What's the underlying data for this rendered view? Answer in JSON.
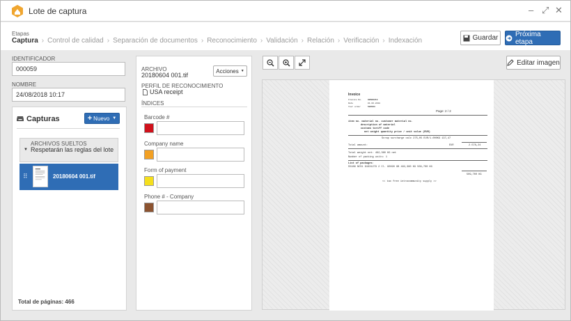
{
  "window": {
    "title": "Lote de captura",
    "minimize": "–",
    "maximize": "⤢",
    "close": "✕"
  },
  "breadcrumb": {
    "label": "Etapas",
    "steps": [
      "Captura",
      "Control de calidad",
      "Separación de documentos",
      "Reconocimiento",
      "Validación",
      "Relación",
      "Verificación",
      "Indexación"
    ],
    "separator": "›"
  },
  "toolbar": {
    "save_label": "Guardar",
    "next_label": "Próxima etapa",
    "edit_image_label": "Editar imagen"
  },
  "batch": {
    "id_label": "IDENTIFICADOR",
    "id_value": "000059",
    "name_label": "NOMBRE",
    "name_value": "24/08/2018 10:17"
  },
  "captures": {
    "title": "Capturas",
    "new_label": "Nuevo",
    "group_label": "ARCHIVOS SUELTOS",
    "group_rule": "Respetarán las reglas del lote",
    "file_name": "20180604 001.tif",
    "total_pages": "Total de páginas: 466"
  },
  "document": {
    "file_label": "ARCHIVO",
    "file_name": "20180604 001.tif",
    "actions_label": "Acciones",
    "profile_label": "PERFIL DE RECONOCIMIENTO",
    "profile_value": "USA receipt",
    "indices_label": "ÍNDICES",
    "indices": [
      {
        "label": "Barcode #",
        "color": "#d0111b",
        "value": ""
      },
      {
        "label": "Company name",
        "color": "#f2a023",
        "value": ""
      },
      {
        "label": "Form of payment",
        "color": "#f5df1d",
        "value": ""
      },
      {
        "label": "Phone # - Company",
        "color": "#8c5330",
        "value": ""
      }
    ]
  },
  "preview": {
    "title": "Invoice",
    "page": "Page:  2 / 2",
    "header_rows": [
      [
        "Invoice No.",
        "90566219"
      ],
      [
        "Date",
        "01.06.2018"
      ],
      [
        "Your order",
        "504563"
      ]
    ],
    "col1": "item no. material no.      customer material no.",
    "col2": "description of material",
    "col3": "customs tariff code",
    "col4": "net weight       quantity          price / unit     value (EUR)",
    "row1": "Scrap surcharge calc           275,05 EUR/1.000KG     137,47",
    "total_label": "Total amount:",
    "total_currency": "EUR",
    "total_value": "2.578,24",
    "weight": "Total weight net:                  492,360 KG net",
    "packing": "Number of packing units:      1",
    "packages_label": "List of packages:",
    "package_row": "55486 NCS1   91931279    2 Cl.   90X90 GB     492,360 KG   509,700 KG",
    "package_total": "509,700 KG",
    "footer": "<<  tax free intracommunity supply  >>"
  }
}
